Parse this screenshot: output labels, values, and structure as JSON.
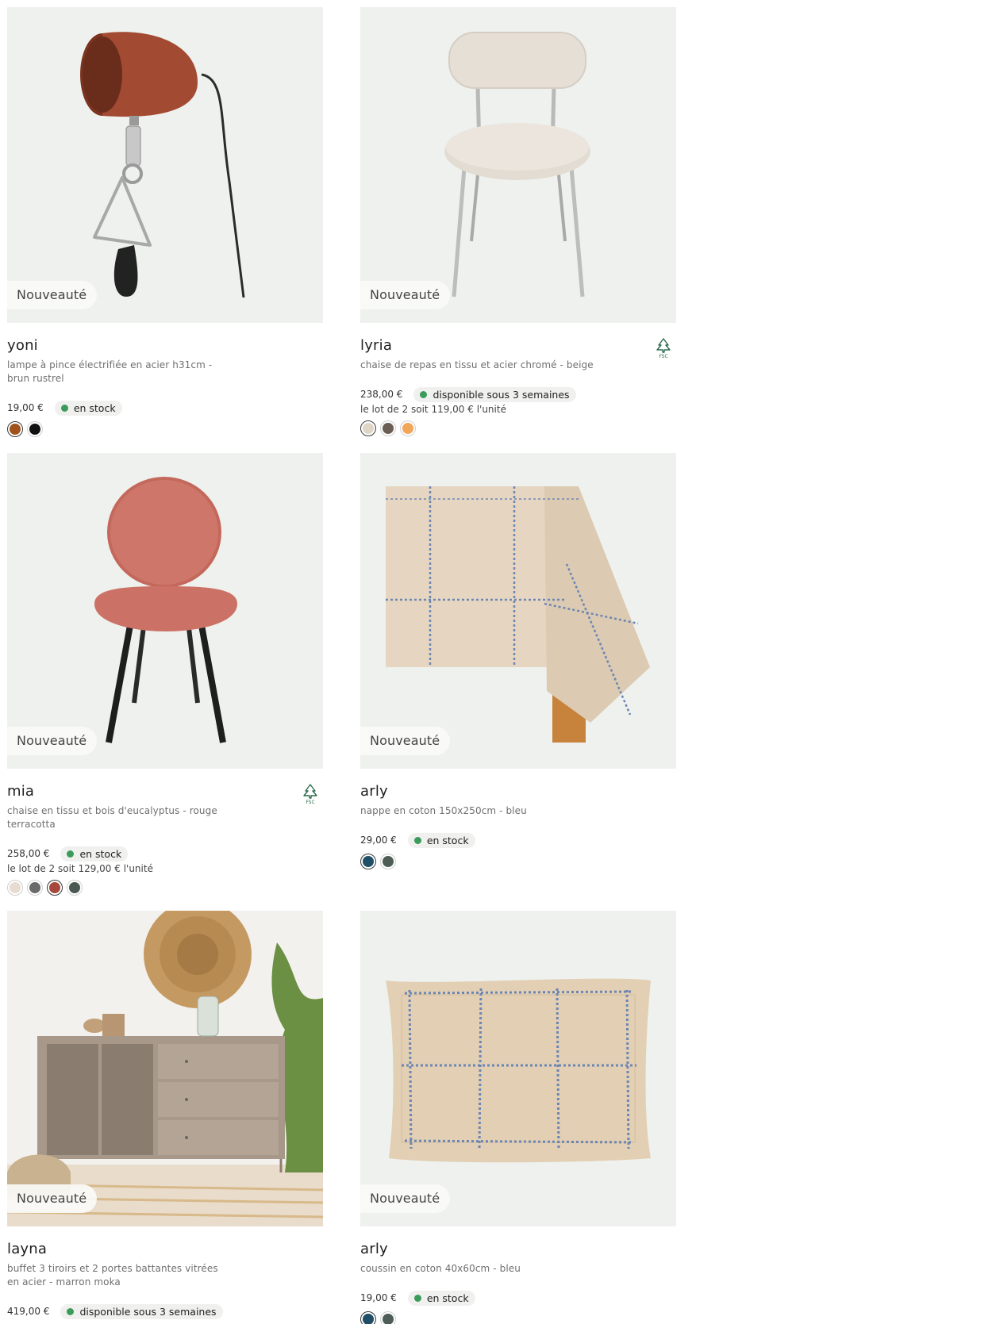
{
  "colors": {
    "accent_green": "#3a9b5a",
    "image_bg": "#eef1ed"
  },
  "products": [
    {
      "badge": "Nouveauté",
      "name": "yoni",
      "desc": "lampe à pince électrifiée en acier h31cm - brun rustrel",
      "price": "19,00 €",
      "stock": "en stock",
      "lot": "",
      "fsc": false,
      "image_icon": "clamp-lamp",
      "swatches": [
        {
          "color": "#a0521c",
          "selected": true
        },
        {
          "color": "#111111",
          "selected": false
        }
      ]
    },
    {
      "badge": "Nouveauté",
      "name": "lyria",
      "desc": "chaise de repas en tissu et acier chromé - beige",
      "price": "238,00 €",
      "stock": "disponible sous 3 semaines",
      "lot": "le lot de 2 soit 119,00 € l'unité",
      "fsc": true,
      "fsc_label": "FSC",
      "image_icon": "beige-chair",
      "swatches": [
        {
          "color": "#e0d6c8",
          "selected": true
        },
        {
          "color": "#6b5f55",
          "selected": false
        },
        {
          "color": "#f2a65a",
          "selected": false
        }
      ]
    },
    {
      "badge": "Nouveauté",
      "name": "mia",
      "desc": "chaise en tissu et bois d'eucalyptus - rouge terracotta",
      "price": "258,00 €",
      "stock": "en stock",
      "lot": "le lot de 2 soit 129,00 € l'unité",
      "fsc": true,
      "fsc_label": "FSC",
      "image_icon": "terracotta-chair",
      "swatches": [
        {
          "color": "#e6dccf",
          "selected": false
        },
        {
          "color": "#6a6a6a",
          "selected": false
        },
        {
          "color": "#a6493c",
          "selected": true
        },
        {
          "color": "#4a5a52",
          "selected": false
        }
      ]
    },
    {
      "badge": "Nouveauté",
      "name": "arly",
      "desc": "nappe en coton 150x250cm - bleu",
      "price": "29,00 €",
      "stock": "en stock",
      "lot": "",
      "fsc": false,
      "image_icon": "tablecloth",
      "swatches": [
        {
          "color": "#1f4e66",
          "selected": true
        },
        {
          "color": "#4f5d57",
          "selected": false
        }
      ]
    },
    {
      "badge": "Nouveauté",
      "name": "layna",
      "desc": "buffet 3 tiroirs et 2 portes battantes vitrées en acier - marron moka",
      "price": "419,00 €",
      "stock": "disponible sous 3 semaines",
      "lot": "",
      "fsc": false,
      "image_icon": "sideboard",
      "swatches": []
    },
    {
      "badge": "Nouveauté",
      "name": "arly",
      "desc": "coussin en coton 40x60cm - bleu",
      "price": "19,00 €",
      "stock": "en stock",
      "lot": "",
      "fsc": false,
      "image_icon": "cushion",
      "swatches": [
        {
          "color": "#1f4e66",
          "selected": true
        },
        {
          "color": "#4f5d57",
          "selected": false
        }
      ]
    }
  ]
}
